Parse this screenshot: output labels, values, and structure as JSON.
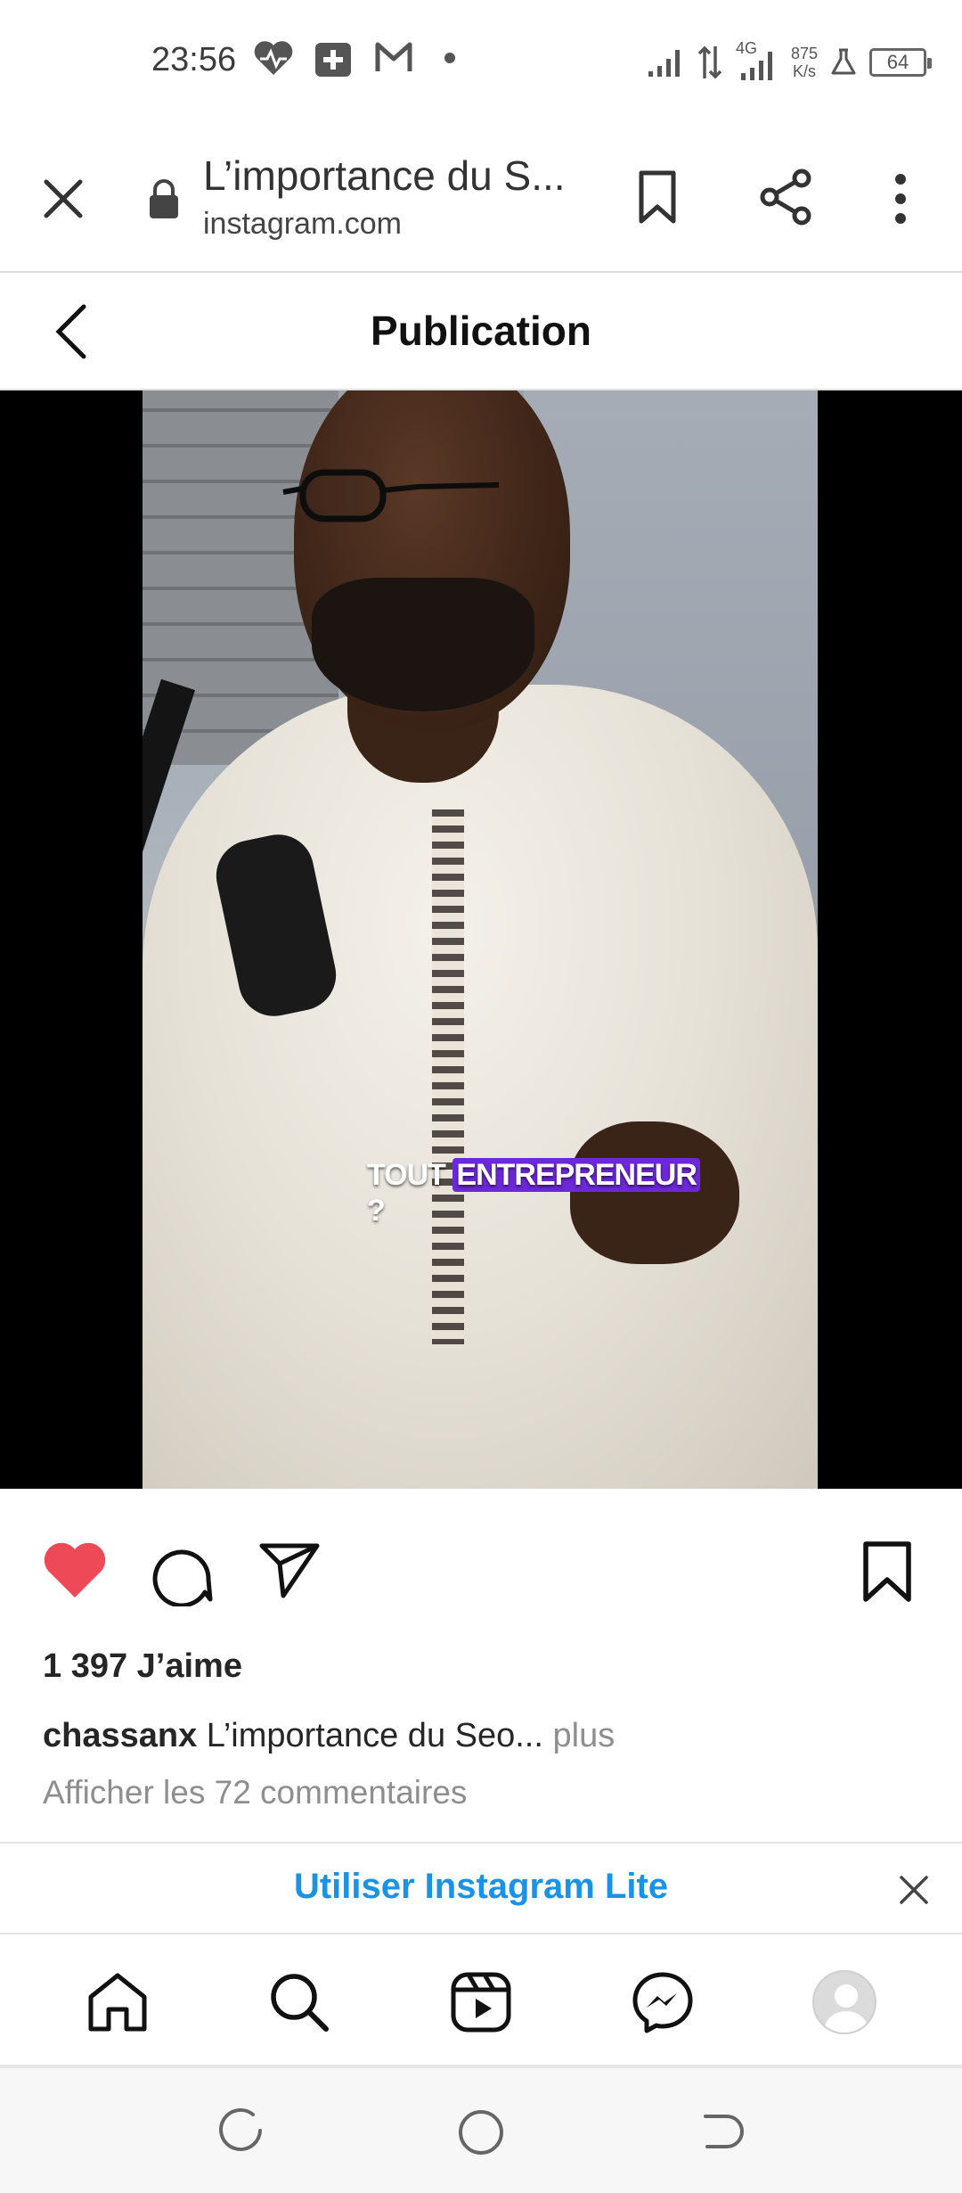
{
  "status_bar": {
    "time": "23:56",
    "network": "4G",
    "speed_value": "875",
    "speed_unit": "K/s",
    "battery": "64",
    "icons": [
      "heart-health-icon",
      "medical-plus-icon",
      "gmail-icon",
      "dot-icon",
      "signal-icon",
      "data-arrows-icon",
      "signal-4g-icon",
      "flask-icon",
      "battery-icon"
    ]
  },
  "browser": {
    "tab_title": "L’importance du S...",
    "domain": "instagram.com",
    "icons": [
      "close-icon",
      "lock-icon",
      "bookmark-icon",
      "share-icon",
      "more-vertical-icon"
    ]
  },
  "header": {
    "title": "Publication",
    "back_icon": "chevron-left-icon"
  },
  "video": {
    "caption_word1": "TOUT",
    "caption_word2": "ENTREPRENEUR",
    "caption_word3": "?",
    "caption_highlight_color": "#6d28d9",
    "mute_icon": "volume-muted-icon"
  },
  "post": {
    "likes": "1 397 J’aime",
    "username": "chassanx",
    "caption": "L’importance du Seo...",
    "more": "plus",
    "comments_link": "Afficher les 72 commentaires",
    "like_color": "#ed4956"
  },
  "banner": {
    "text": "Utiliser Instagram Lite",
    "color": "#1a93e6"
  },
  "bottom_nav": [
    "home-icon",
    "search-icon",
    "reels-icon",
    "messenger-icon",
    "profile-avatar"
  ],
  "system_nav": [
    "recent-apps-icon",
    "home-circle-icon",
    "back-icon"
  ]
}
